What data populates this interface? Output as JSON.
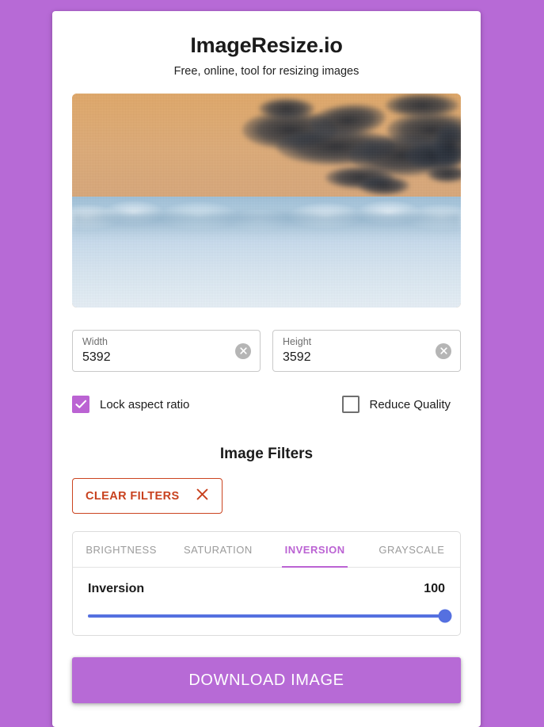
{
  "theme": {
    "background": "#b76ad6",
    "accent": "#bb63d3",
    "slider_color": "#5570e0",
    "danger": "#c8411e"
  },
  "header": {
    "title": "ImageResize.io",
    "subtitle": "Free, online, tool for resizing images"
  },
  "preview": {
    "alt": "inverted photo of a landscape with dark clouds over a tan sky and pale blue terrain"
  },
  "dimensions": {
    "width": {
      "label": "Width",
      "value": "5392",
      "clear_icon": "close-circle-icon"
    },
    "height": {
      "label": "Height",
      "value": "3592",
      "clear_icon": "close-circle-icon"
    }
  },
  "options": [
    {
      "label": "Lock aspect ratio",
      "checked": true
    },
    {
      "label": "Reduce Quality",
      "checked": false
    }
  ],
  "filters": {
    "title": "Image Filters",
    "clear_label": "CLEAR FILTERS",
    "clear_icon": "close-x-icon",
    "tabs": [
      {
        "label": "BRIGHTNESS",
        "active": false
      },
      {
        "label": "SATURATION",
        "active": false
      },
      {
        "label": "INVERSION",
        "active": true
      },
      {
        "label": "GRAYSCALE",
        "active": false
      }
    ],
    "slider": {
      "name": "Inversion",
      "value": "100",
      "min": 0,
      "max": 100,
      "percent": 100
    }
  },
  "actions": {
    "download_label": "DOWNLOAD IMAGE"
  }
}
